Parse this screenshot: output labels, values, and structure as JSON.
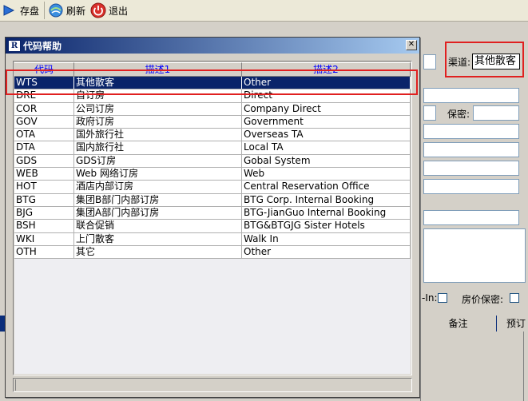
{
  "toolbar": {
    "save_label": "存盘",
    "refresh_label": "刷新",
    "exit_label": "退出"
  },
  "background_form": {
    "channel_label": "渠道:",
    "channel_value": "其他散客",
    "confidential_label": "保密:",
    "checkin_label": "-In:",
    "rate_confidential_label": "房价保密:",
    "grid_col_remark": "备注",
    "grid_col_booking": "预订"
  },
  "dialog": {
    "title": "代码帮助",
    "icon_letter": "R",
    "columns": [
      "代码",
      "描述1",
      "描述2"
    ],
    "rows": [
      {
        "code": "WTS",
        "desc1": "其他散客",
        "desc2": "Other",
        "selected": true
      },
      {
        "code": "DRE",
        "desc1": "自订房",
        "desc2": "Direct"
      },
      {
        "code": "COR",
        "desc1": "公司订房",
        "desc2": "Company Direct"
      },
      {
        "code": "GOV",
        "desc1": "政府订房",
        "desc2": "Government"
      },
      {
        "code": "OTA",
        "desc1": "国外旅行社",
        "desc2": "Overseas TA"
      },
      {
        "code": "DTA",
        "desc1": "国内旅行社",
        "desc2": "Local TA"
      },
      {
        "code": "GDS",
        "desc1": "GDS订房",
        "desc2": "Gobal System"
      },
      {
        "code": "WEB",
        "desc1": "Web 网络订房",
        "desc2": "Web"
      },
      {
        "code": "HOT",
        "desc1": "酒店内部订房",
        "desc2": "Central Reservation Office"
      },
      {
        "code": "BTG",
        "desc1": "集团B部门内部订房",
        "desc2": "BTG Corp. Internal Booking"
      },
      {
        "code": "BJG",
        "desc1": "集团A部门内部订房",
        "desc2": "BTG-JianGuo Internal Booking"
      },
      {
        "code": "BSH",
        "desc1": "联合促销",
        "desc2": "BTG&BTGJG Sister Hotels"
      },
      {
        "code": "WKI",
        "desc1": "上门散客",
        "desc2": "Walk In"
      },
      {
        "code": "OTH",
        "desc1": "其它",
        "desc2": "Other"
      }
    ]
  },
  "colors": {
    "selection": "#0a246a",
    "header_text": "#0000ff",
    "highlight_box": "#e02020"
  }
}
